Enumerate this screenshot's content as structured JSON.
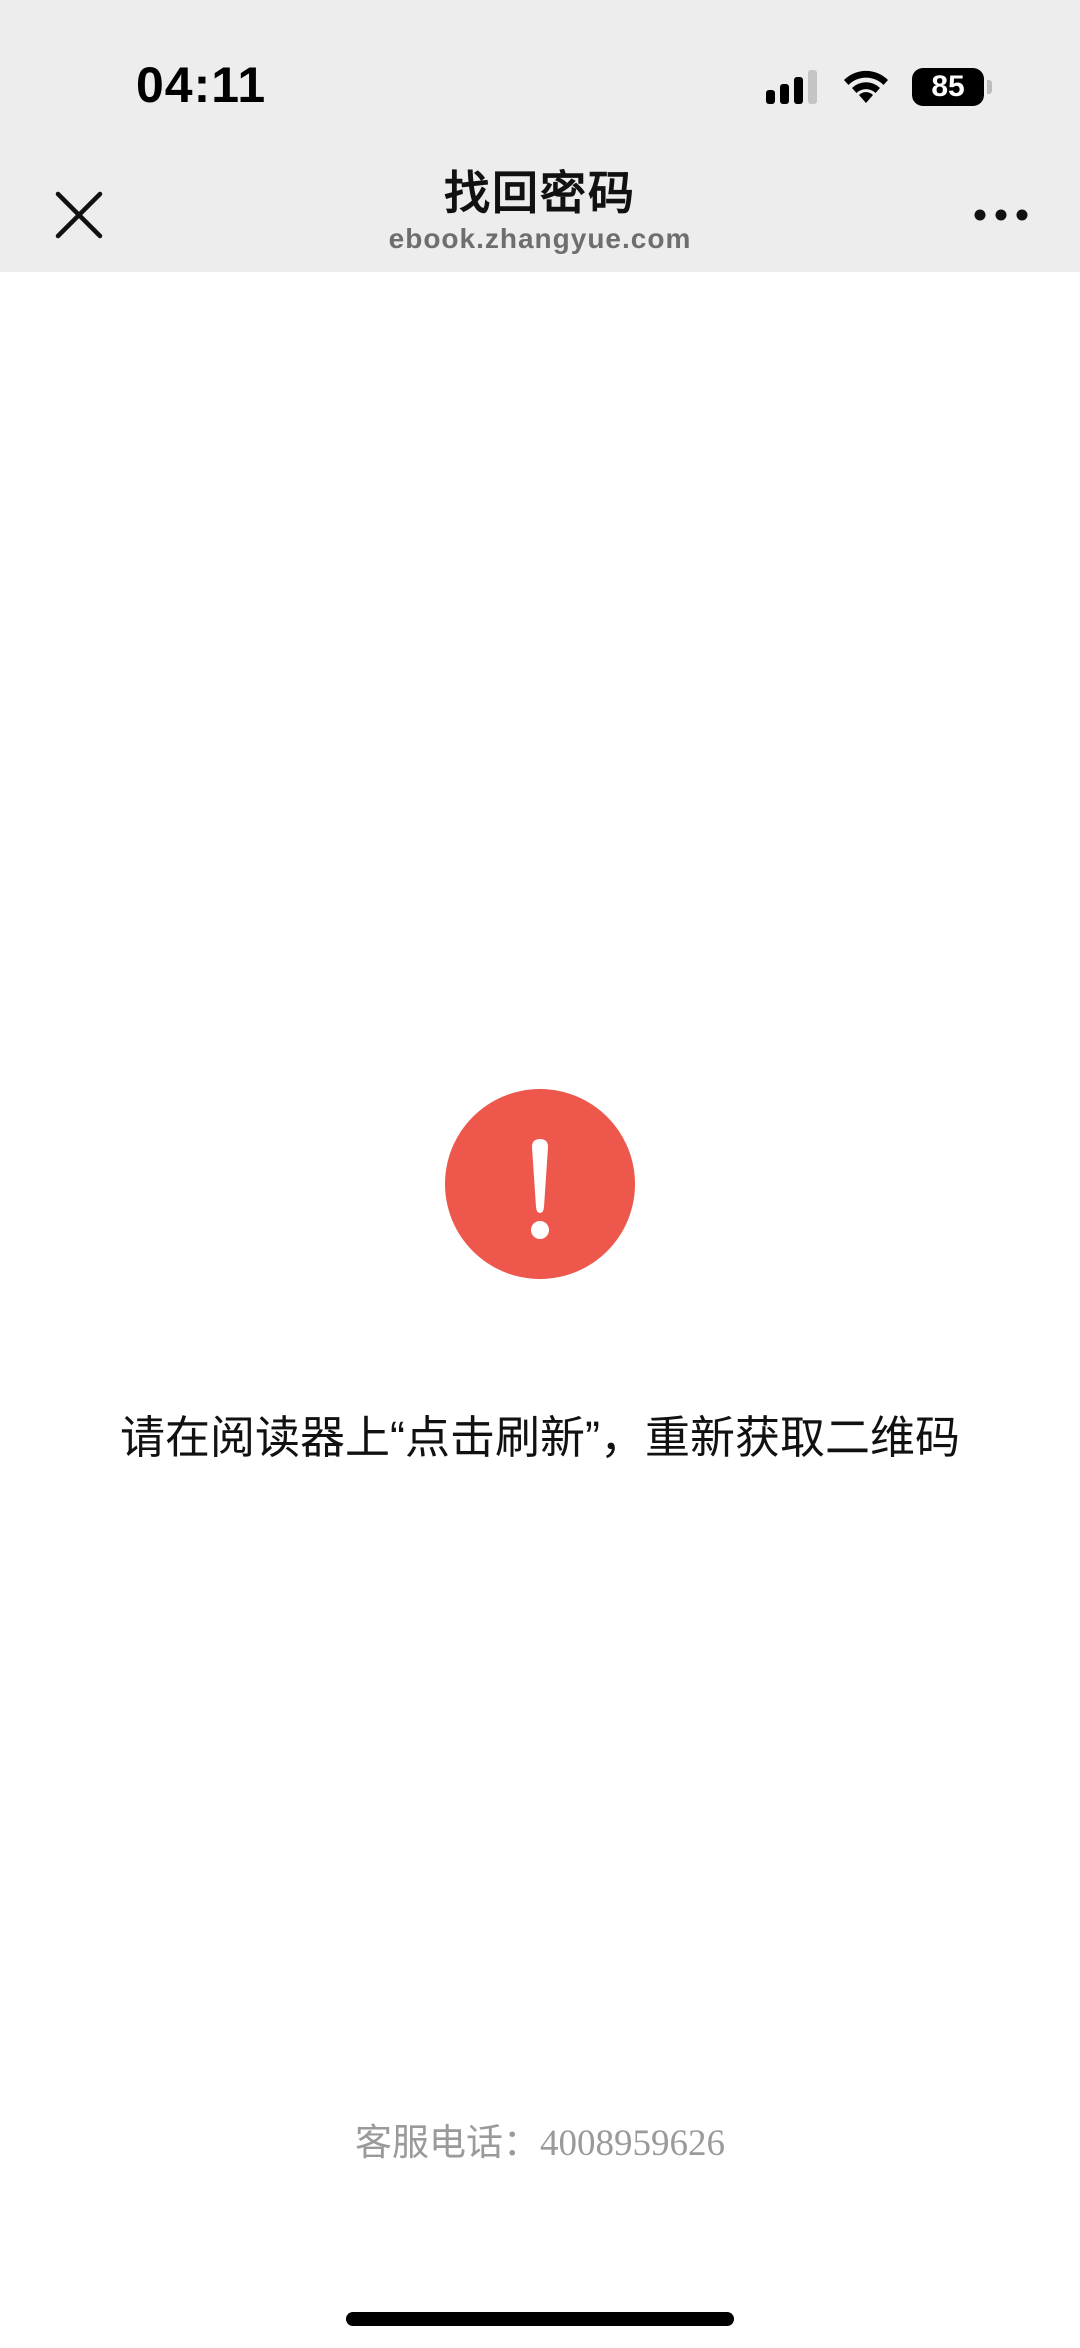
{
  "status_bar": {
    "time": "04:11",
    "battery_level": "85",
    "icons": [
      "cellular-signal-icon",
      "wifi-icon",
      "battery-icon"
    ]
  },
  "nav_bar": {
    "title": "找回密码",
    "subtitle": "ebook.zhangyue.com",
    "left_icon": "close-icon",
    "right_icon": "more-icon"
  },
  "content": {
    "alert_icon": "exclamation-icon",
    "alert_color": "#ed574c",
    "message": "请在阅读器上“点击刷新”，重新获取二维码",
    "hotline_label": "客服电话：",
    "hotline_number": "4008959626"
  }
}
